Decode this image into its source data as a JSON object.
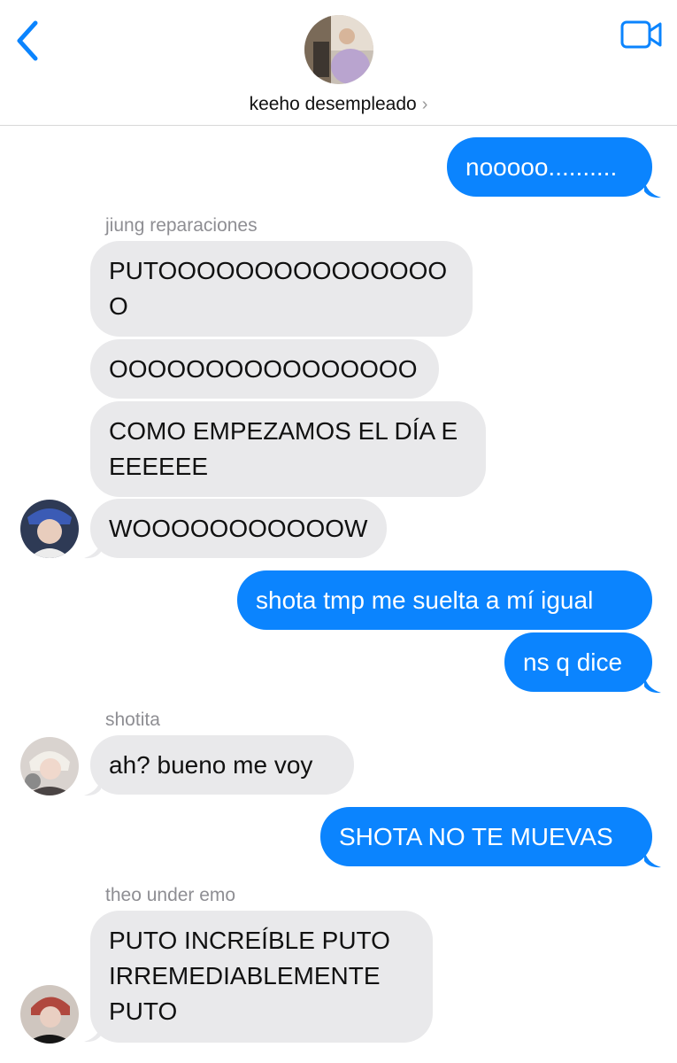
{
  "header": {
    "contact_name": "keeho desempleado",
    "back_icon": "chevron-left-icon",
    "video_icon": "video-camera-icon",
    "accent_color": "#0b84fe"
  },
  "messages": [
    {
      "direction": "outgoing",
      "text": "nooooo.........."
    },
    {
      "direction": "incoming",
      "sender": "jiung reparaciones",
      "text": "PUTOOOOOOOOOOOOOOOO"
    },
    {
      "direction": "incoming",
      "text": "OOOOOOOOOOOOOOOO"
    },
    {
      "direction": "incoming",
      "text": "COMO EMPEZAMOS EL DÍA EEEEEEE"
    },
    {
      "direction": "incoming",
      "text": "WOOOOOOOOOOOW"
    },
    {
      "direction": "outgoing",
      "text": "shota tmp me suelta a mí igual"
    },
    {
      "direction": "outgoing",
      "text": "ns q dice"
    },
    {
      "direction": "incoming",
      "sender": "shotita",
      "text": "ah? bueno me voy"
    },
    {
      "direction": "outgoing",
      "text": "SHOTA NO TE MUEVAS"
    },
    {
      "direction": "incoming",
      "sender": "theo under emo",
      "text": "PUTO INCREÍBLE PUTO IRREMEDIABLEMENTE PUTO"
    }
  ]
}
